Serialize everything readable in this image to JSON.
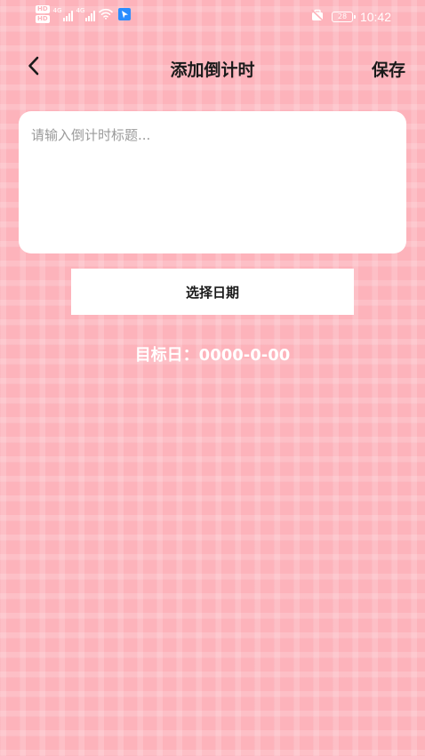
{
  "status_bar": {
    "hd_badge_1": "HD",
    "hd_badge_2": "HD",
    "network_1": "4G",
    "network_2": "4G",
    "battery": "28",
    "time": "10:42",
    "icons": [
      "hd-icon",
      "signal-icon",
      "wifi-icon",
      "app-notification-icon",
      "silent-icon",
      "battery-icon"
    ]
  },
  "header": {
    "title": "添加倒计时",
    "save_label": "保存",
    "back_icon": "chevron-left-icon"
  },
  "title_input": {
    "value": "",
    "placeholder": "请输入倒计时标题..."
  },
  "select_date": {
    "label": "选择日期"
  },
  "target": {
    "text": "目标日：0000-0-00"
  },
  "colors": {
    "background": "#fdb3bb",
    "card": "#ffffff",
    "text_dark": "#1a1a1a",
    "placeholder": "#9a9a9a",
    "target_text": "#ffffff"
  }
}
